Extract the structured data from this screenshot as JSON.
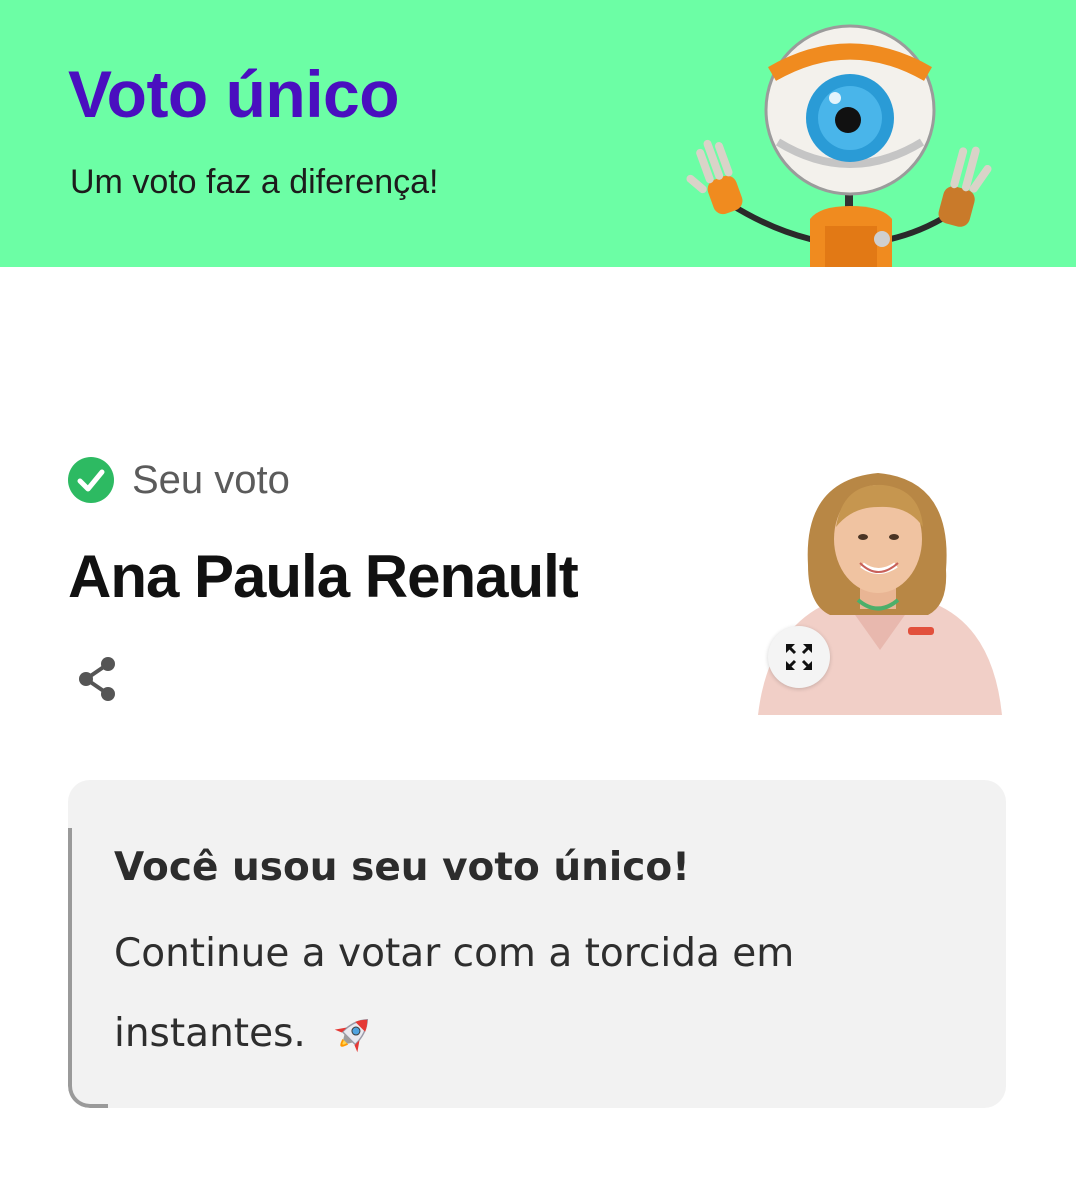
{
  "banner": {
    "title": "Voto único",
    "subtitle": "Um voto faz a diferença!",
    "background_color": "#6cfea5",
    "title_color": "#4a0fbf",
    "mascot_icon": "bbb-eye-mascot"
  },
  "vote": {
    "label": "Seu voto",
    "status_icon": "check-circle-icon",
    "status_color": "#2dba62",
    "candidate_name": "Ana Paula Renault",
    "share_icon": "share-icon",
    "expand_icon": "expand-icon"
  },
  "info_card": {
    "title": "Você usou seu voto único!",
    "body": "Continue a votar com a torcida em instantes.",
    "emoji_icon": "rocket-icon"
  }
}
